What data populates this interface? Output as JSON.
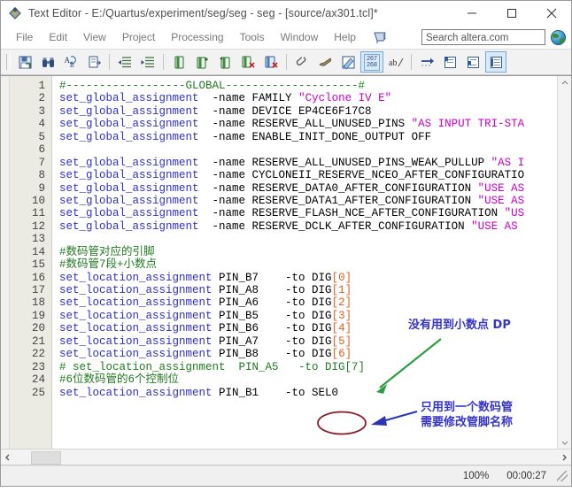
{
  "window": {
    "title": "Text Editor - E:/Quartus/experiment/seg/seg - seg - [source/ax301.tcl]*",
    "app_icon": "quartus-icon",
    "minimize_label": "─",
    "maximize_label": "□",
    "close_label": "✕"
  },
  "menubar": {
    "items": [
      {
        "label": "File",
        "name": "menu-file"
      },
      {
        "label": "Edit",
        "name": "menu-edit"
      },
      {
        "label": "View",
        "name": "menu-view"
      },
      {
        "label": "Project",
        "name": "menu-project"
      },
      {
        "label": "Processing",
        "name": "menu-processing"
      },
      {
        "label": "Tools",
        "name": "menu-tools"
      },
      {
        "label": "Window",
        "name": "menu-window"
      },
      {
        "label": "Help",
        "name": "menu-help"
      }
    ],
    "flag_icon": "comment-flag-icon"
  },
  "search": {
    "value": "Search altera.com",
    "placeholder": "Search altera.com",
    "globe_icon": "globe-icon"
  },
  "toolbar": {
    "buttons": [
      {
        "name": "save-as-icon",
        "glyph": "save"
      },
      {
        "name": "find-binoculars-icon",
        "glyph": "find"
      },
      {
        "name": "replace-icon",
        "glyph": "replace"
      },
      {
        "name": "goto-line-icon",
        "glyph": "goto"
      },
      {
        "name": "indent-decrease-icon",
        "glyph": "outdent"
      },
      {
        "name": "indent-increase-icon",
        "glyph": "indent"
      },
      {
        "name": "comment-block-icon",
        "glyph": "doc1"
      },
      {
        "name": "uncomment-block-icon",
        "glyph": "doc2"
      },
      {
        "name": "insert-template-icon",
        "glyph": "doc3"
      },
      {
        "name": "remove-doc-icon",
        "glyph": "doc4"
      },
      {
        "name": "delete-doc-icon",
        "glyph": "doc5"
      },
      {
        "name": "attach-clip-icon",
        "glyph": "clip"
      },
      {
        "name": "scroll-doc-icon",
        "glyph": "scroll"
      },
      {
        "name": "color-coding-icon",
        "glyph": "colorize"
      }
    ],
    "line_number_toggle": {
      "name": "line-number-toggle",
      "line_top": "267",
      "line_bottom": "268"
    },
    "ab_toggle": {
      "name": "ab-wrap-toggle",
      "label": "ab"
    },
    "right_buttons": [
      {
        "name": "goto-arrow-icon",
        "glyph": "arrow"
      },
      {
        "name": "bookmark-prev-icon",
        "glyph": "bm1"
      },
      {
        "name": "bookmark-next-icon",
        "glyph": "bm2"
      },
      {
        "name": "bookmark-all-icon",
        "glyph": "bm3",
        "active": true
      }
    ]
  },
  "editor": {
    "line_numbers": [
      "1",
      "2",
      "3",
      "4",
      "5",
      "6",
      "7",
      "8",
      "9",
      "10",
      "11",
      "12",
      "13",
      "14",
      "15",
      "16",
      "17",
      "18",
      "19",
      "20",
      "21",
      "22",
      "23",
      "24",
      "25"
    ],
    "lines": [
      [
        {
          "t": "cmt",
          "s": "#------------------GLOBAL--------------------#"
        }
      ],
      [
        {
          "t": "cmd",
          "s": "set_global_assignment"
        },
        {
          "t": "plain",
          "s": "  -name FAMILY "
        },
        {
          "t": "str",
          "s": "\"Cyclone IV E\""
        }
      ],
      [
        {
          "t": "cmd",
          "s": "set_global_assignment"
        },
        {
          "t": "plain",
          "s": "  -name DEVICE EP4CE6F17C8"
        }
      ],
      [
        {
          "t": "cmd",
          "s": "set_global_assignment"
        },
        {
          "t": "plain",
          "s": "  -name RESERVE_ALL_UNUSED_PINS "
        },
        {
          "t": "str",
          "s": "\"AS INPUT TRI-STA"
        }
      ],
      [
        {
          "t": "cmd",
          "s": "set_global_assignment"
        },
        {
          "t": "plain",
          "s": "  -name ENABLE_INIT_DONE_OUTPUT OFF"
        }
      ],
      [],
      [
        {
          "t": "cmd",
          "s": "set_global_assignment"
        },
        {
          "t": "plain",
          "s": "  -name RESERVE_ALL_UNUSED_PINS_WEAK_PULLUP "
        },
        {
          "t": "str",
          "s": "\"AS I"
        }
      ],
      [
        {
          "t": "cmd",
          "s": "set_global_assignment"
        },
        {
          "t": "plain",
          "s": "  -name CYCLONEII_RESERVE_NCEO_AFTER_CONFIGURATIO"
        }
      ],
      [
        {
          "t": "cmd",
          "s": "set_global_assignment"
        },
        {
          "t": "plain",
          "s": "  -name RESERVE_DATA0_AFTER_CONFIGURATION "
        },
        {
          "t": "str",
          "s": "\"USE AS"
        }
      ],
      [
        {
          "t": "cmd",
          "s": "set_global_assignment"
        },
        {
          "t": "plain",
          "s": "  -name RESERVE_DATA1_AFTER_CONFIGURATION "
        },
        {
          "t": "str",
          "s": "\"USE AS"
        }
      ],
      [
        {
          "t": "cmd",
          "s": "set_global_assignment"
        },
        {
          "t": "plain",
          "s": "  -name RESERVE_FLASH_NCE_AFTER_CONFIGURATION "
        },
        {
          "t": "str",
          "s": "\"US"
        }
      ],
      [
        {
          "t": "cmd",
          "s": "set_global_assignment"
        },
        {
          "t": "plain",
          "s": "  -name RESERVE_DCLK_AFTER_CONFIGURATION "
        },
        {
          "t": "str",
          "s": "\"USE AS"
        }
      ],
      [],
      [
        {
          "t": "cmt",
          "s": "#数码管对应的引脚"
        }
      ],
      [
        {
          "t": "cmt",
          "s": "#数码管7段+小数点"
        }
      ],
      [
        {
          "t": "cmd",
          "s": "set_location_assignment"
        },
        {
          "t": "plain",
          "s": " PIN_B7    -to DIG"
        },
        {
          "t": "idx",
          "s": "[0]"
        }
      ],
      [
        {
          "t": "cmd",
          "s": "set_location_assignment"
        },
        {
          "t": "plain",
          "s": " PIN_A8    -to DIG"
        },
        {
          "t": "idx",
          "s": "[1]"
        }
      ],
      [
        {
          "t": "cmd",
          "s": "set_location_assignment"
        },
        {
          "t": "plain",
          "s": " PIN_A6    -to DIG"
        },
        {
          "t": "idx",
          "s": "[2]"
        }
      ],
      [
        {
          "t": "cmd",
          "s": "set_location_assignment"
        },
        {
          "t": "plain",
          "s": " PIN_B5    -to DIG"
        },
        {
          "t": "idx",
          "s": "[3]"
        }
      ],
      [
        {
          "t": "cmd",
          "s": "set_location_assignment"
        },
        {
          "t": "plain",
          "s": " PIN_B6    -to DIG"
        },
        {
          "t": "idx",
          "s": "[4]"
        }
      ],
      [
        {
          "t": "cmd",
          "s": "set_location_assignment"
        },
        {
          "t": "plain",
          "s": " PIN_A7    -to DIG"
        },
        {
          "t": "idx",
          "s": "[5]"
        }
      ],
      [
        {
          "t": "cmd",
          "s": "set_location_assignment"
        },
        {
          "t": "plain",
          "s": " PIN_B8    -to DIG"
        },
        {
          "t": "idx",
          "s": "[6]"
        }
      ],
      [
        {
          "t": "cmt",
          "s": "# set_location_assignment  PIN_A5   -to DIG[7]"
        }
      ],
      [
        {
          "t": "cmt",
          "s": "#6位数码管的6个控制位"
        }
      ],
      [
        {
          "t": "cmd",
          "s": "set_location_assignment"
        },
        {
          "t": "plain",
          "s": " PIN_B1    -to SEL0"
        }
      ]
    ]
  },
  "annotations": {
    "note_dp": "没有用到小数点 DP",
    "note_sel_line1": "只用到一个数码管",
    "note_sel_line2": "需要修改管脚名称",
    "arrow_green_color": "#2a9d3f",
    "arrow_blue_color": "#2a35b0",
    "ellipse_color": "#8b1a2b",
    "text_color": "#3535c8"
  },
  "statusbar": {
    "zoom": "100%",
    "elapsed": "00:00:27"
  }
}
